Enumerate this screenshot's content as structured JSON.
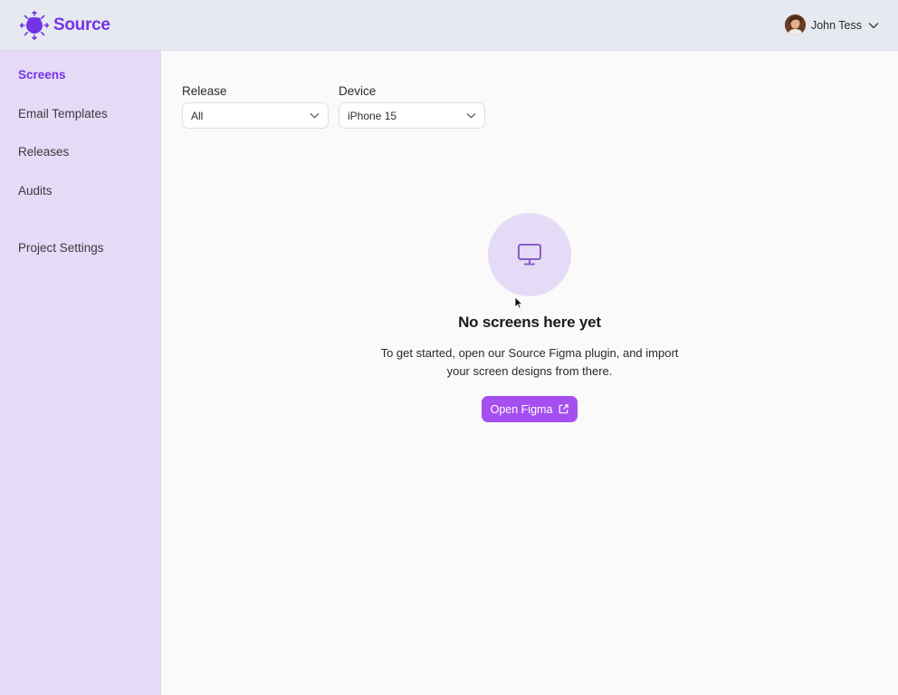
{
  "header": {
    "brand_name": "Source",
    "user_name": "John Tess"
  },
  "sidebar": {
    "items": [
      {
        "label": "Screens",
        "active": true
      },
      {
        "label": "Email Templates",
        "active": false
      },
      {
        "label": "Releases",
        "active": false
      },
      {
        "label": "Audits",
        "active": false
      }
    ],
    "settings_label": "Project Settings"
  },
  "filters": {
    "release": {
      "label": "Release",
      "value": "All"
    },
    "device": {
      "label": "Device",
      "value": "iPhone 15"
    }
  },
  "empty_state": {
    "title": "No screens here yet",
    "description": "To get started, open our Source Figma plugin, and import your screen designs from there.",
    "button_label": "Open Figma",
    "icon": "monitor-icon"
  },
  "colors": {
    "accent": "#7433e6",
    "button": "#a64ff0",
    "sidebar_bg": "#e6dbf6",
    "header_bg": "#e6e9f0"
  }
}
